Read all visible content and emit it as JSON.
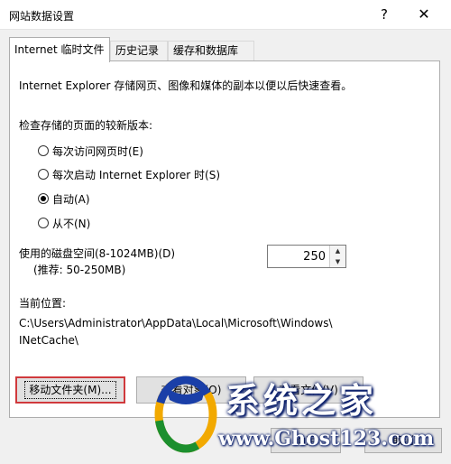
{
  "window": {
    "title": "网站数据设置",
    "help_label": "?",
    "close_label": "✕"
  },
  "tabs": [
    {
      "label": "Internet 临时文件",
      "active": true
    },
    {
      "label": "历史记录",
      "active": false
    },
    {
      "label": "缓存和数据库",
      "active": false
    }
  ],
  "panel": {
    "description": "Internet Explorer 存储网页、图像和媒体的副本以便以后快速查看。",
    "check_heading": "检查存储的页面的较新版本:",
    "options": [
      {
        "label": "每次访问网页时(E)",
        "selected": false
      },
      {
        "label": "每次启动 Internet Explorer 时(S)",
        "selected": false
      },
      {
        "label": "自动(A)",
        "selected": true
      },
      {
        "label": "从不(N)",
        "selected": false
      }
    ],
    "disk_space_label": "使用的磁盘空间(8-1024MB)(D)",
    "disk_space_recommend": "(推荐: 50-250MB)",
    "disk_space_value": "250",
    "location_heading": "当前位置:",
    "location_path_line1": "C:\\Users\\Administrator\\AppData\\Local\\Microsoft\\Windows\\",
    "location_path_line2": "INetCache\\",
    "buttons": {
      "move_folder": "移动文件夹(M)...",
      "view_objects": "查看对象(O)",
      "view_files": "查看文件(V)"
    }
  },
  "footer": {
    "ok_label": "确定",
    "cancel_label": "取消"
  },
  "watermark": {
    "title": "系统之家",
    "url": "www.Ghost123.com"
  }
}
